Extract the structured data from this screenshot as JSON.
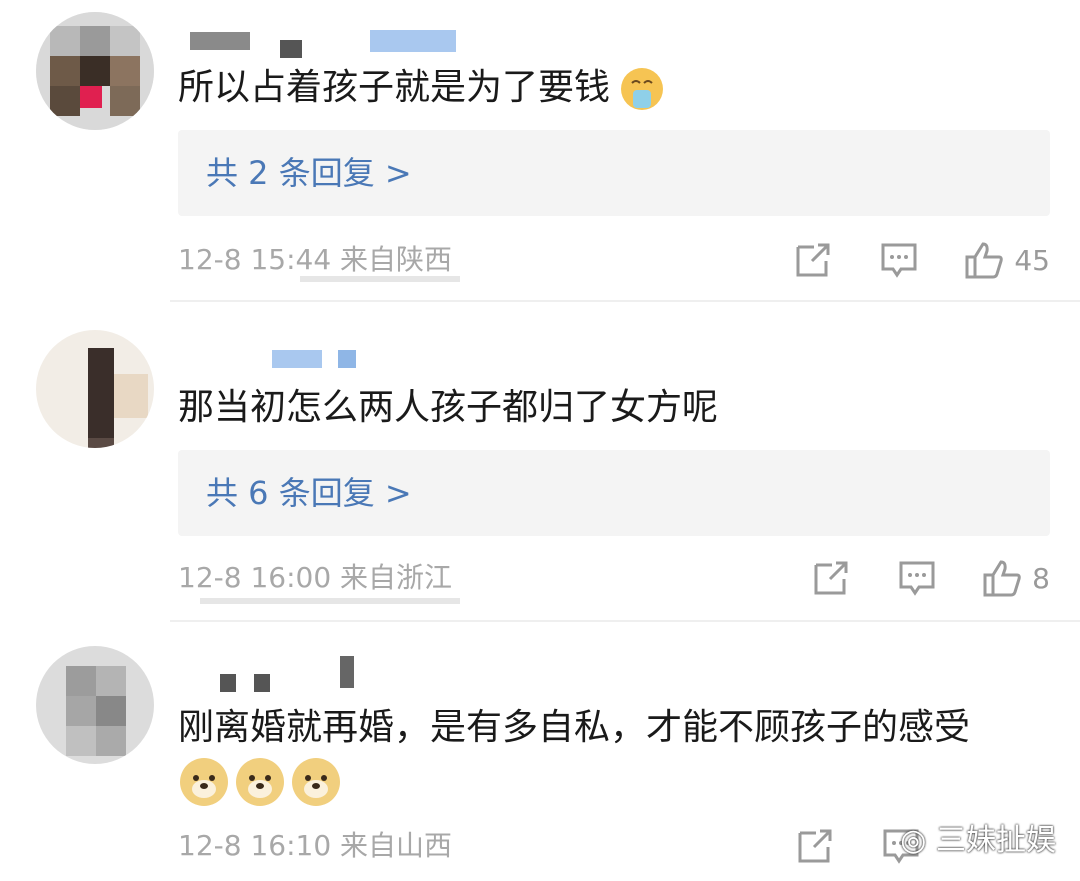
{
  "comments": [
    {
      "text": "所以占着孩子就是为了要钱",
      "emoji": "vomit-emoji",
      "reply_link": "共 2 条回复 >",
      "time": "12-8 15:44",
      "location": "来自陕西",
      "likes": "45"
    },
    {
      "text": "那当初怎么两人孩子都归了女方呢",
      "reply_link": "共 6 条回复 >",
      "time": "12-8 16:00",
      "location": "来自浙江",
      "likes": "8"
    },
    {
      "text": "刚离婚就再婚，是有多自私，才能不顾孩子的感受",
      "emojis": [
        "doge-emoji",
        "doge-emoji",
        "doge-emoji"
      ],
      "time": "12-8 16:10",
      "location": "来自山西"
    }
  ],
  "watermark": "三妹扯娱",
  "colors": {
    "reply_link": "#4a78b6",
    "meta_text": "#a8a8a8",
    "reply_bg": "#f4f4f4",
    "avatar_tones": [
      "#8a8a8a",
      "#5a4a3c",
      "#e02050",
      "#c8c8c8"
    ]
  }
}
